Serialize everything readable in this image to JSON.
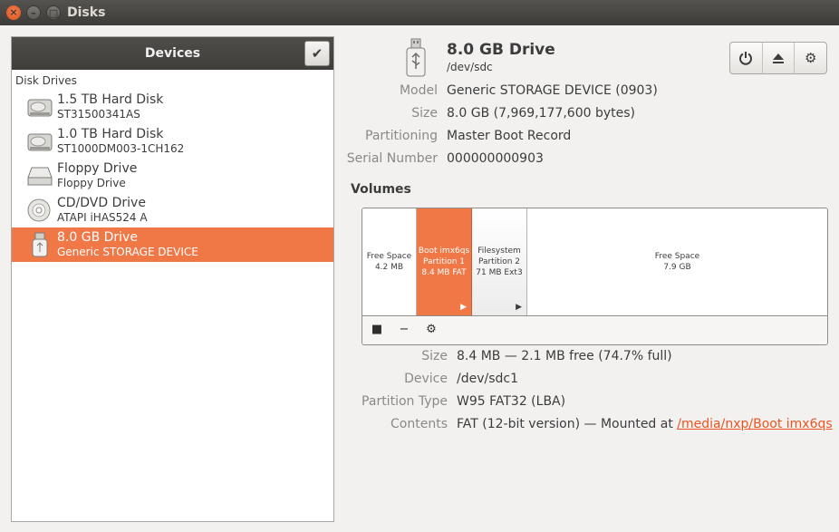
{
  "window": {
    "title": "Disks"
  },
  "sidebar": {
    "header": "Devices",
    "section": "Disk Drives",
    "devices": [
      {
        "name": "1.5 TB Hard Disk",
        "sub": "ST31500341AS"
      },
      {
        "name": "1.0 TB Hard Disk",
        "sub": "ST1000DM003-1CH162"
      },
      {
        "name": "Floppy Drive",
        "sub": "Floppy Drive"
      },
      {
        "name": "CD/DVD Drive",
        "sub": "ATAPI   iHAS524   A"
      },
      {
        "name": "8.0 GB Drive",
        "sub": "Generic STORAGE DEVICE"
      }
    ]
  },
  "drive": {
    "title": "8.0 GB Drive",
    "path": "/dev/sdc",
    "props": [
      {
        "label": "Model",
        "value": "Generic STORAGE DEVICE (0903)"
      },
      {
        "label": "Size",
        "value": "8.0 GB (7,969,177,600 bytes)"
      },
      {
        "label": "Partitioning",
        "value": "Master Boot Record"
      },
      {
        "label": "Serial Number",
        "value": "000000000903"
      }
    ]
  },
  "volumes": {
    "title": "Volumes",
    "segments": [
      {
        "line1": "Free Space",
        "line2": "4.2 MB",
        "line3": ""
      },
      {
        "line1": "Boot imx6qs",
        "line2": "Partition 1",
        "line3": "8.4 MB FAT"
      },
      {
        "line1": "Filesystem",
        "line2": "Partition 2",
        "line3": "71 MB Ext3"
      },
      {
        "line1": "Free Space",
        "line2": "7.9 GB",
        "line3": ""
      }
    ],
    "details": [
      {
        "label": "Size",
        "value": "8.4 MB — 2.1 MB free (74.7% full)"
      },
      {
        "label": "Device",
        "value": "/dev/sdc1"
      },
      {
        "label": "Partition Type",
        "value": "W95 FAT32 (LBA)"
      }
    ],
    "contents": {
      "label": "Contents",
      "text": "FAT (12-bit version) — Mounted at ",
      "link": "/media/nxp/Boot imx6qs"
    }
  },
  "colors": {
    "accent": "#f07746",
    "titlebar": "#3c3b37"
  }
}
